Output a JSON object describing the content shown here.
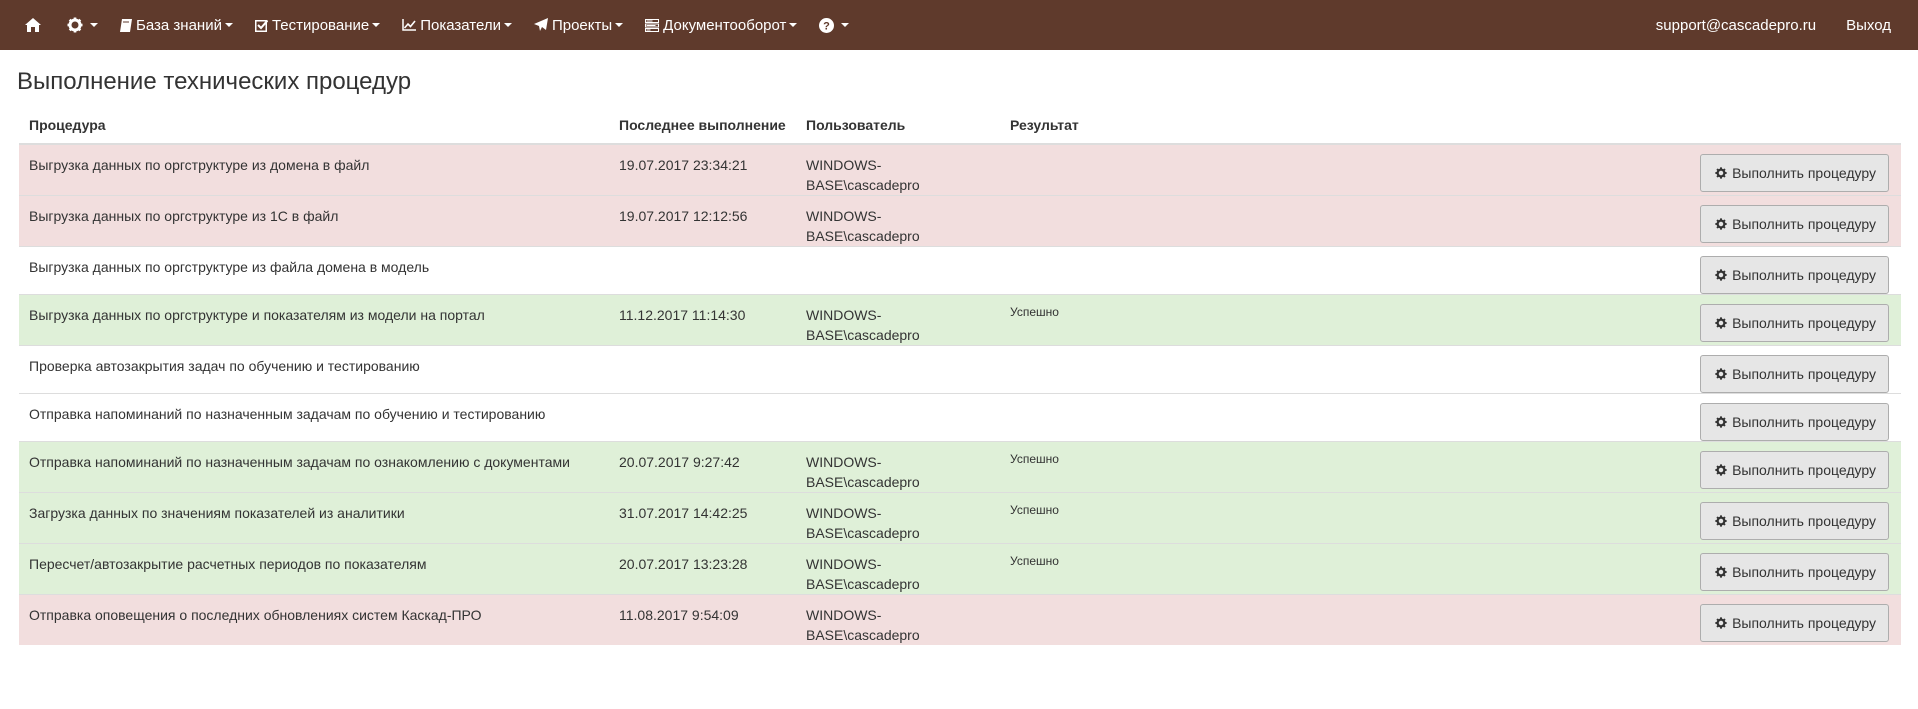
{
  "navbar": {
    "items": [
      {
        "label": "",
        "icon": "home-icon"
      },
      {
        "label": "",
        "icon": "gear-icon"
      },
      {
        "label": "База знаний",
        "icon": "book-icon"
      },
      {
        "label": "Тестирование",
        "icon": "checkbox-icon"
      },
      {
        "label": "Показатели",
        "icon": "line-chart-icon"
      },
      {
        "label": "Проекты",
        "icon": "send-icon"
      },
      {
        "label": "Документооборот",
        "icon": "tasks-icon"
      },
      {
        "label": "",
        "icon": "question-icon"
      }
    ],
    "user_email": "support@cascadepro.ru",
    "logout_label": "Выход",
    "bg_color": "#5f3a2c"
  },
  "page": {
    "title": "Выполнение технических процедур"
  },
  "table": {
    "headers": [
      "Процедура",
      "Последнее выполнение",
      "Пользователь",
      "Результат"
    ],
    "button_label": "Выполнить процедуру",
    "rows": [
      {
        "procedure": "Выгрузка данных по оргструктуре из домена в файл",
        "last_run": "19.07.2017 23:34:21",
        "user": "WINDOWS-BASE\\cascadepro",
        "result": "",
        "status": "danger"
      },
      {
        "procedure": "Выгрузка данных по оргструктуре из 1С в файл",
        "last_run": "19.07.2017 12:12:56",
        "user": "WINDOWS-BASE\\cascadepro",
        "result": "",
        "status": "danger"
      },
      {
        "procedure": "Выгрузка данных по оргструктуре из файла домена в модель",
        "last_run": "",
        "user": "",
        "result": "",
        "status": "default"
      },
      {
        "procedure": "Выгрузка данных по оргструктуре и показателям из модели на портал",
        "last_run": "11.12.2017 11:14:30",
        "user": "WINDOWS-BASE\\cascadepro",
        "result": "Успешно",
        "status": "success"
      },
      {
        "procedure": "Проверка автозакрытия задач по обучению и тестированию",
        "last_run": "",
        "user": "",
        "result": "",
        "status": "default"
      },
      {
        "procedure": "Отправка напоминаний по назначенным задачам по обучению и тестированию",
        "last_run": "",
        "user": "",
        "result": "",
        "status": "default"
      },
      {
        "procedure": "Отправка напоминаний по назначенным задачам по ознакомлению с документами",
        "last_run": "20.07.2017 9:27:42",
        "user": "WINDOWS-BASE\\cascadepro",
        "result": "Успешно",
        "status": "success"
      },
      {
        "procedure": "Загрузка данных по значениям показателей из аналитики",
        "last_run": "31.07.2017 14:42:25",
        "user": "WINDOWS-BASE\\cascadepro",
        "result": "Успешно",
        "status": "success"
      },
      {
        "procedure": "Пересчет/автозакрытие расчетных периодов по показателям",
        "last_run": "20.07.2017 13:23:28",
        "user": "WINDOWS-BASE\\cascadepro",
        "result": "Успешно",
        "status": "success"
      },
      {
        "procedure": "Отправка оповещения о последних обновлениях систем Каскад-ПРО",
        "last_run": "11.08.2017 9:54:09",
        "user": "WINDOWS-BASE\\cascadepro",
        "result": "",
        "status": "danger"
      }
    ]
  },
  "colors": {
    "danger_row": "#f2dede",
    "success_row": "#dff0d8",
    "button_bg": "#e6e6e6"
  }
}
